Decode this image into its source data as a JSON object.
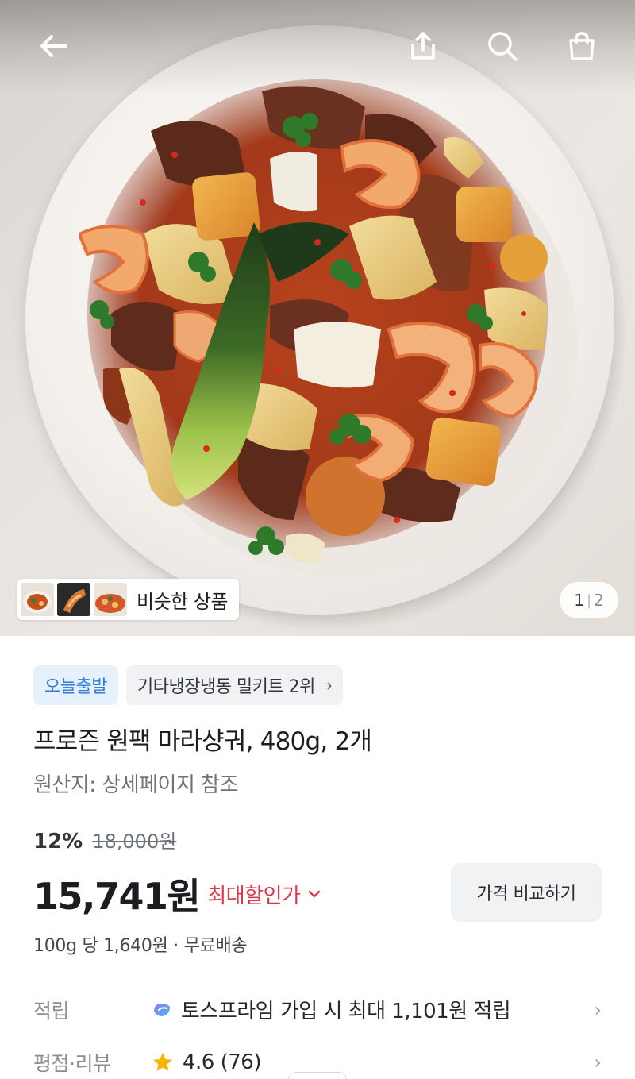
{
  "colors": {
    "accent_blue": "#2f7bd8",
    "discount_red": "#e0364a",
    "badge_blue_bg": "#e6f1fd",
    "chip_gray_bg": "#f1f2f4",
    "star_yellow": "#f7b500"
  },
  "header": {
    "icons": [
      "back-arrow-icon",
      "share-icon",
      "search-icon",
      "shopping-bag-icon"
    ]
  },
  "gallery": {
    "similar_label": "비슷한 상품",
    "current_page": "1",
    "separator": "|",
    "total_pages": "2"
  },
  "badges": {
    "shipping": "오늘출발",
    "ranking": "기타냉장냉동 밀키트 2위",
    "ranking_chevron": "›"
  },
  "product": {
    "title": "프로즌 원팩 마라샹궈, 480g, 2개",
    "origin": "원산지: 상세페이지 참조",
    "discount_rate": "12%",
    "original_price": "18,000원",
    "price": "15,741원",
    "max_discount_label": "최대할인가",
    "max_discount_caret": "⌄",
    "compare_button": "가격 비교하기",
    "unit_info": "100g 당 1,640원 · 무료배송"
  },
  "rows": {
    "points": {
      "label": "적립",
      "value": "토스프라임 가입 시 최대 1,101원 적립",
      "arrow": "›"
    },
    "review": {
      "label": "평점·리뷰",
      "value": "4.6 (76)",
      "arrow": "›"
    }
  }
}
